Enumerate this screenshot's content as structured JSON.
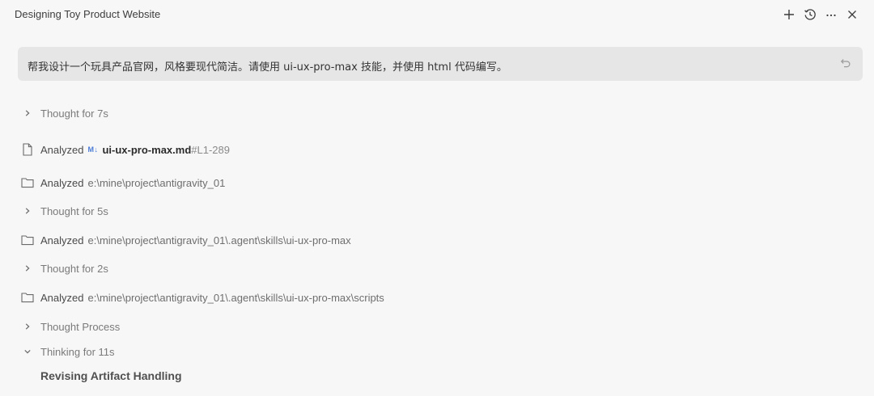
{
  "header": {
    "title": "Designing Toy Product Website",
    "icons": [
      "plus-icon",
      "history-icon",
      "more-icon",
      "close-icon"
    ]
  },
  "prompt": {
    "text": "帮我设计一个玩具产品官网，风格要现代简洁。请使用 ui-ux-pro-max 技能，并使用 html 代码编写。",
    "icon": "undo-icon"
  },
  "steps": [
    {
      "type": "thought",
      "label": "Thought for 7s"
    },
    {
      "type": "analyzed-file",
      "verb": "Analyzed",
      "badge": "M↓",
      "file": "ui-ux-pro-max.md",
      "lines": "#L1-289"
    },
    {
      "type": "analyzed-folder",
      "verb": "Analyzed",
      "path": "e:\\mine\\project\\antigravity_01"
    },
    {
      "type": "thought",
      "label": "Thought for 5s"
    },
    {
      "type": "analyzed-folder",
      "verb": "Analyzed",
      "path": "e:\\mine\\project\\antigravity_01\\.agent\\skills\\ui-ux-pro-max"
    },
    {
      "type": "thought",
      "label": "Thought for 2s"
    },
    {
      "type": "analyzed-folder",
      "verb": "Analyzed",
      "path": "e:\\mine\\project\\antigravity_01\\.agent\\skills\\ui-ux-pro-max\\scripts"
    },
    {
      "type": "thought",
      "label": "Thought Process"
    },
    {
      "type": "thinking",
      "label": "Thinking for 11s",
      "expanded": true
    }
  ],
  "artifact": {
    "heading": "Revising Artifact Handling"
  },
  "colors": {
    "background": "#f7f7f7",
    "prompt_bg": "#e6e6e6",
    "md_badge": "#4a7bd6"
  }
}
